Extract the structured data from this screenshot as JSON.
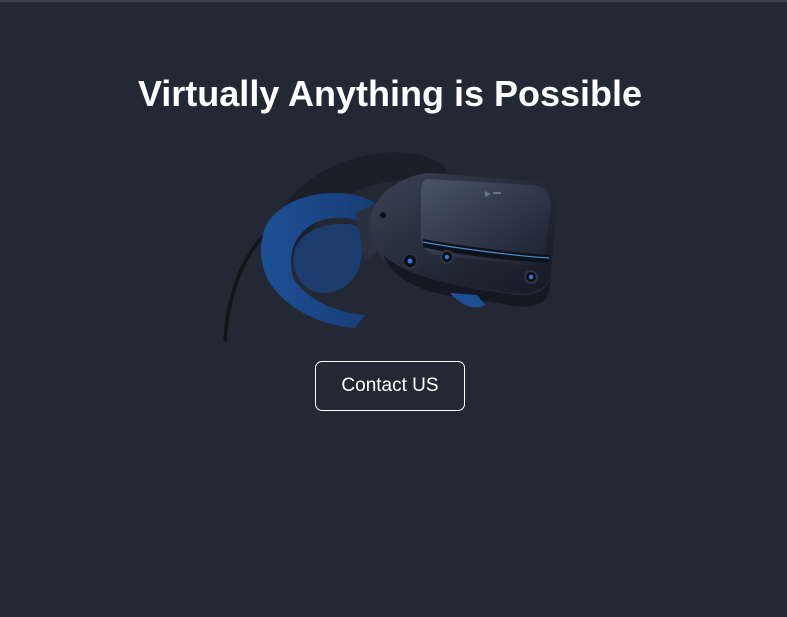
{
  "hero": {
    "title": "Virtually Anything is Possible",
    "image_subject": "vr-headset",
    "contact_button_label": "Contact US"
  },
  "colors": {
    "background": "#222934",
    "text": "#ffffff",
    "button_border": "#ffffff",
    "headset_accent": "#2a5fa8"
  }
}
